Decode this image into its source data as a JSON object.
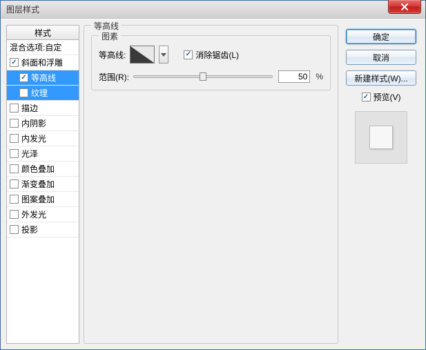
{
  "window": {
    "title": "图层样式"
  },
  "buttons": {
    "close": "X",
    "ok": "确定",
    "cancel": "取消",
    "new_style": "新建样式(W)..."
  },
  "right": {
    "preview_label": "预览(V)",
    "preview_checked": true
  },
  "sidebar": {
    "header": "样式",
    "items": [
      {
        "label": "混合选项:自定",
        "checked": null,
        "indent": 0,
        "selected": false
      },
      {
        "label": "斜面和浮雕",
        "checked": true,
        "indent": 0,
        "selected": false
      },
      {
        "label": "等高线",
        "checked": true,
        "indent": 1,
        "selected": true
      },
      {
        "label": "纹理",
        "checked": false,
        "indent": 1,
        "selected": true
      },
      {
        "label": "描边",
        "checked": false,
        "indent": 0,
        "selected": false
      },
      {
        "label": "内阴影",
        "checked": false,
        "indent": 0,
        "selected": false
      },
      {
        "label": "内发光",
        "checked": false,
        "indent": 0,
        "selected": false
      },
      {
        "label": "光泽",
        "checked": false,
        "indent": 0,
        "selected": false
      },
      {
        "label": "颜色叠加",
        "checked": false,
        "indent": 0,
        "selected": false
      },
      {
        "label": "渐变叠加",
        "checked": false,
        "indent": 0,
        "selected": false
      },
      {
        "label": "图案叠加",
        "checked": false,
        "indent": 0,
        "selected": false
      },
      {
        "label": "外发光",
        "checked": false,
        "indent": 0,
        "selected": false
      },
      {
        "label": "投影",
        "checked": false,
        "indent": 0,
        "selected": false
      }
    ]
  },
  "main": {
    "group_title": "等高线",
    "subgroup_title": "图素",
    "contour_label": "等高线:",
    "antialias_label": "消除锯齿(L)",
    "antialias_checked": true,
    "range_label": "范围(R):",
    "range_value": "50",
    "range_percent": 50,
    "range_unit": "%"
  }
}
